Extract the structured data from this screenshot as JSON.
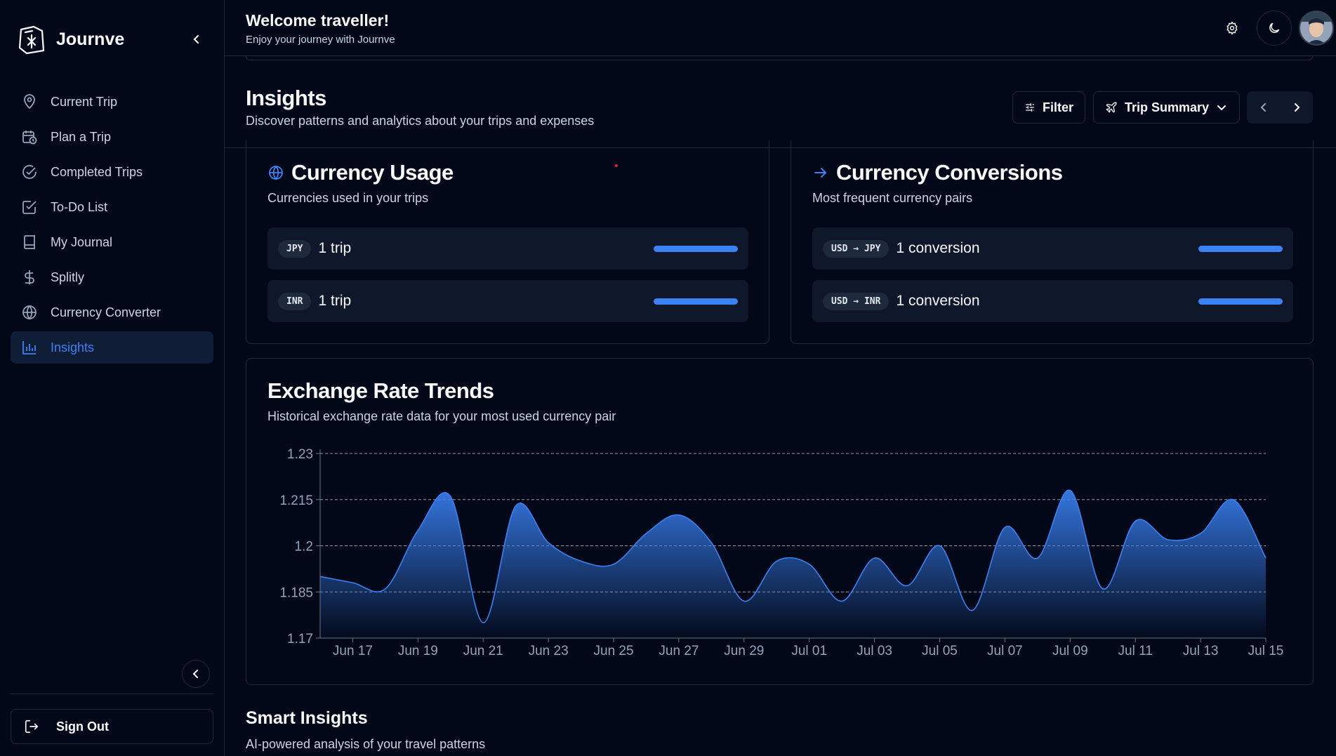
{
  "brand": {
    "name": "Journve"
  },
  "sidebar": {
    "items": [
      {
        "label": "Current Trip",
        "icon": "map-pin-icon"
      },
      {
        "label": "Plan a Trip",
        "icon": "calendar-clock-icon"
      },
      {
        "label": "Completed Trips",
        "icon": "check-circle-icon"
      },
      {
        "label": "To-Do List",
        "icon": "checkbox-icon"
      },
      {
        "label": "My Journal",
        "icon": "book-icon"
      },
      {
        "label": "Splitly",
        "icon": "dollar-icon"
      },
      {
        "label": "Currency Converter",
        "icon": "globe-icon"
      },
      {
        "label": "Insights",
        "icon": "bar-chart-icon",
        "active": true
      }
    ],
    "sign_out": "Sign Out"
  },
  "header": {
    "welcome": "Welcome traveller!",
    "subtitle": "Enjoy your journey with Journve"
  },
  "page": {
    "title": "Insights",
    "subtitle": "Discover patterns and analytics about your trips and expenses",
    "filter_label": "Filter",
    "summary_label": "Trip Summary"
  },
  "currency_usage": {
    "title": "Currency Usage",
    "subtitle": "Currencies used in your trips",
    "rows": [
      {
        "code": "JPY",
        "text": "1 trip",
        "fill": 1.0
      },
      {
        "code": "INR",
        "text": "1 trip",
        "fill": 1.0
      }
    ]
  },
  "currency_conversions": {
    "title": "Currency Conversions",
    "subtitle": "Most frequent currency pairs",
    "rows": [
      {
        "code": "USD → JPY",
        "text": "1 conversion",
        "fill": 1.0
      },
      {
        "code": "USD → INR",
        "text": "1 conversion",
        "fill": 1.0
      }
    ]
  },
  "exchange": {
    "title": "Exchange Rate Trends",
    "subtitle": "Historical exchange rate data for your most used currency pair"
  },
  "smart": {
    "title": "Smart Insights",
    "subtitle": "AI-powered analysis of your travel patterns"
  },
  "colors": {
    "accent": "#3b82f6",
    "background": "#020817",
    "border": "#1e293b"
  },
  "chart_data": {
    "type": "area",
    "title": "Exchange Rate Trends",
    "xlabel": "",
    "ylabel": "",
    "ylim": [
      1.17,
      1.23
    ],
    "yticks": [
      "1.23",
      "1.215",
      "1.2",
      "1.185",
      "1.17"
    ],
    "xticks": [
      "Jun 17",
      "Jun 19",
      "Jun 21",
      "Jun 23",
      "Jun 25",
      "Jun 27",
      "Jun 29",
      "Jul 01",
      "Jul 03",
      "Jul 05",
      "Jul 07",
      "Jul 09",
      "Jul 11",
      "Jul 13",
      "Jul 15"
    ],
    "grid": true,
    "x": [
      "Jun 16",
      "Jun 17",
      "Jun 18",
      "Jun 19",
      "Jun 20",
      "Jun 21",
      "Jun 22",
      "Jun 23",
      "Jun 24",
      "Jun 25",
      "Jun 26",
      "Jun 27",
      "Jun 28",
      "Jun 29",
      "Jun 30",
      "Jul 01",
      "Jul 02",
      "Jul 03",
      "Jul 04",
      "Jul 05",
      "Jul 06",
      "Jul 07",
      "Jul 08",
      "Jul 09",
      "Jul 10",
      "Jul 11",
      "Jul 12",
      "Jul 13",
      "Jul 14",
      "Jul 15"
    ],
    "series": [
      {
        "values": [
          1.19,
          1.188,
          1.186,
          1.205,
          1.216,
          1.175,
          1.213,
          1.201,
          1.195,
          1.194,
          1.204,
          1.21,
          1.201,
          1.182,
          1.195,
          1.194,
          1.182,
          1.196,
          1.187,
          1.2,
          1.179,
          1.206,
          1.196,
          1.218,
          1.186,
          1.208,
          1.202,
          1.204,
          1.215,
          1.196
        ]
      }
    ]
  }
}
